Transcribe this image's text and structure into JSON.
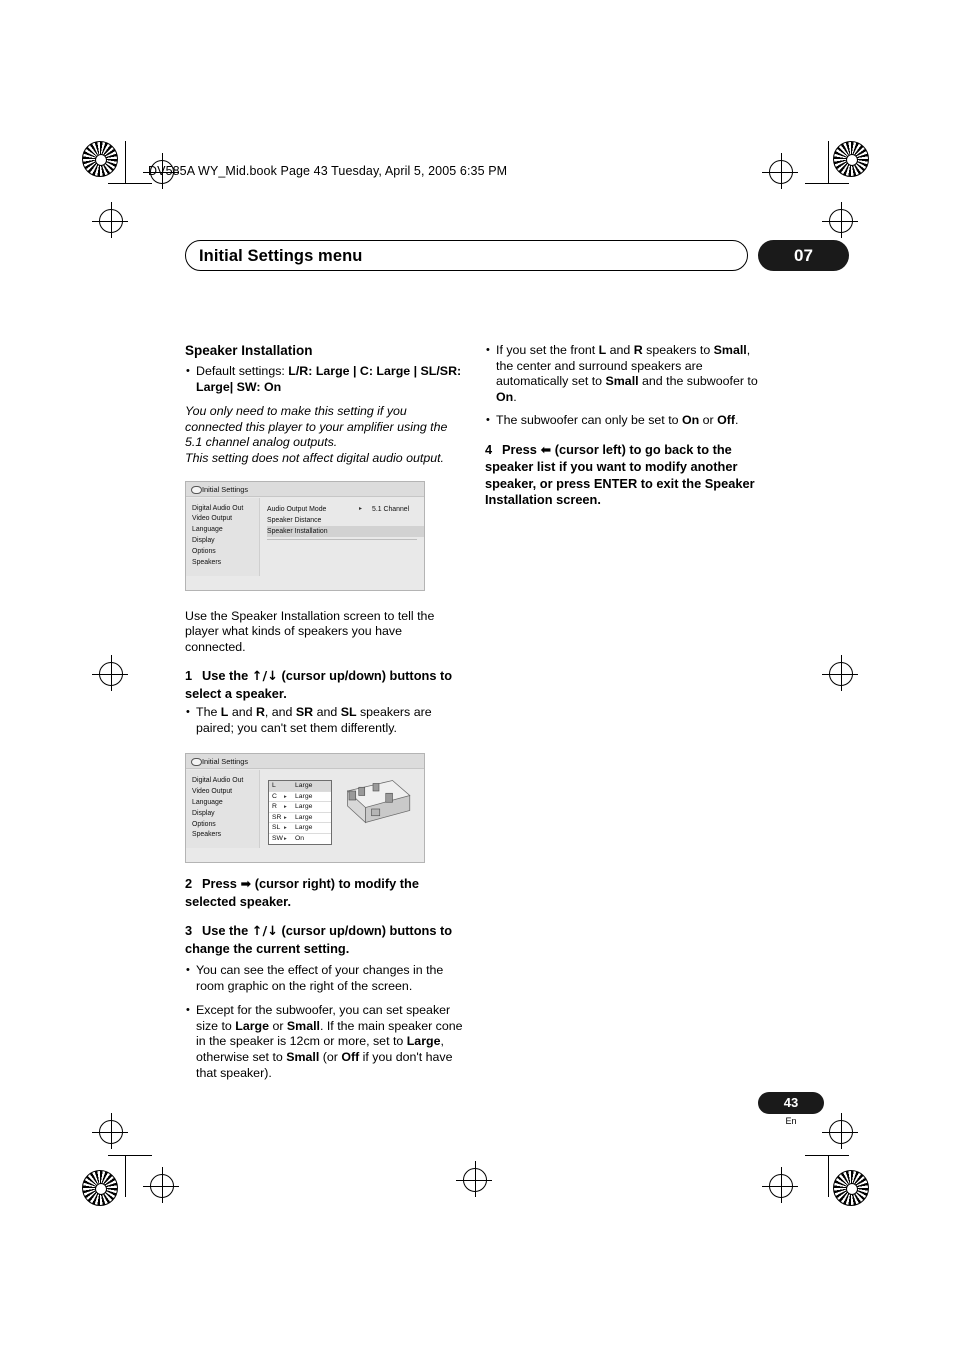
{
  "header": {
    "file_line": "DV585A WY_Mid.book  Page 43  Tuesday, April  5, 2005  6:35 PM"
  },
  "title_bar": {
    "title": "Initial Settings menu",
    "chapter": "07"
  },
  "left_column": {
    "section_heading": "Speaker Installation",
    "default_settings_bullet_prefix": "Default settings: ",
    "default_settings_values": "L/R: Large | C: Large | SL/SR: Large| SW: On",
    "italic_note_1": "You only need to make this setting if you connected this player to your amplifier using the 5.1 channel analog outputs.",
    "italic_note_2": "This setting does not affect digital audio output.",
    "osd1": {
      "title": "Initial Settings",
      "menu_items": [
        "Digital Audio Out",
        "Video Output",
        "Language",
        "Display",
        "Options",
        "Speakers"
      ],
      "rows": [
        {
          "label": "Audio Output Mode",
          "value": "5.1 Channel",
          "arrow": "▸"
        },
        {
          "label": "Speaker Distance",
          "value": "",
          "arrow": ""
        },
        {
          "label": "Speaker Installation",
          "value": "",
          "arrow": ""
        }
      ]
    },
    "para_after_osd1": "Use the Speaker Installation screen to tell the player what kinds of speakers you have connected.",
    "step1": {
      "num": "1",
      "text_before": "Use the ",
      "icons": "↑/↓",
      "text_after": " (cursor up/down) buttons to select a speaker."
    },
    "step1_bullet": "The L and R, and SR and SL speakers are paired; you can't set them differently.",
    "osd2": {
      "title": "Initial Settings",
      "menu_items": [
        "Digital Audio Out",
        "Video Output",
        "Language",
        "Display",
        "Options",
        "Speakers"
      ],
      "speakers": [
        {
          "name": "L",
          "value": "Large",
          "arrow": ""
        },
        {
          "name": "C",
          "value": "Large",
          "arrow": "▸"
        },
        {
          "name": "R",
          "value": "Large",
          "arrow": "▸"
        },
        {
          "name": "SR",
          "value": "Large",
          "arrow": "▸"
        },
        {
          "name": "SL",
          "value": "Large",
          "arrow": "▸"
        },
        {
          "name": "SW",
          "value": "On",
          "arrow": "▸"
        }
      ]
    },
    "step2": {
      "num": "2",
      "text_before": "Press ",
      "icons": "➡",
      "text_after": " (cursor right) to modify the selected speaker."
    },
    "step3": {
      "num": "3",
      "text_before": "Use the ",
      "icons": "↑/↓",
      "text_after": " (cursor up/down) buttons to change the current setting."
    },
    "step3_bullet1": "You can see the effect of your changes in the room graphic on the right of the screen.",
    "step3_bullet2": "Except for the subwoofer, you can set speaker size to Large or Small. If the main speaker cone in the speaker is 12cm or more, set to Large, otherwise set to Small (or Off if you don't have that speaker)."
  },
  "right_column": {
    "bullet1": "If you set the front L and R speakers to Small, the center and surround speakers are automatically set to Small and the subwoofer to On.",
    "bullet2": "The subwoofer can only be set to On or Off.",
    "step4": {
      "num": "4",
      "text_before": "Press ",
      "icons": "⬅",
      "text_after": " (cursor left) to go back to the speaker list if you want to modify another speaker, or press ENTER to exit the Speaker Installation screen."
    }
  },
  "footer": {
    "page_number": "43",
    "language": "En"
  }
}
